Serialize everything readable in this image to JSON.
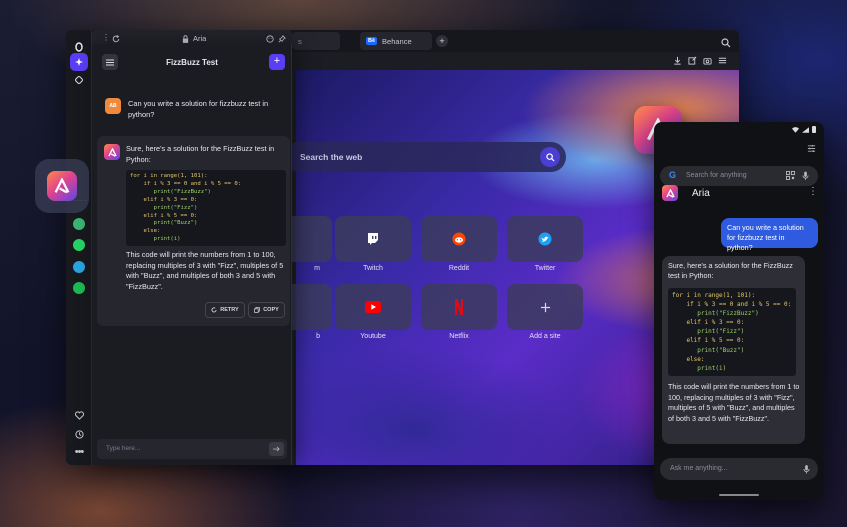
{
  "browser": {
    "tabs": [
      {
        "label": "s"
      },
      {
        "label": "Behance",
        "badge": "Bē"
      }
    ],
    "search_placeholder": "Search the web"
  },
  "speed_dial": {
    "tiles": [
      {
        "label": "m"
      },
      {
        "label": "Twitch",
        "icon": "twitch-icon"
      },
      {
        "label": "Reddit",
        "icon": "reddit-icon"
      },
      {
        "label": "Twitter",
        "icon": "twitter-icon"
      },
      {
        "label": "b"
      },
      {
        "label": "Youtube",
        "icon": "youtube-icon"
      },
      {
        "label": "Netflix",
        "icon": "netflix-icon"
      },
      {
        "label": "Add a site",
        "icon": "plus-icon"
      }
    ]
  },
  "aria": {
    "url_title": "Aria",
    "chat_title": "FizzBuzz Test",
    "user_prompt": "Can you write a solution for fizzbuzz test in python?",
    "reply_intro": "Sure, here's a solution for the FizzBuzz test in Python:",
    "reply_outro": "This code will print the numbers from 1 to 100, replacing multiples of 3 with \"Fizz\", multiples of 5 with \"Buzz\", and multiples of both 3 and 5 with \"FizzBuzz\".",
    "retry_label": "RETRY",
    "copy_label": "COPY",
    "input_placeholder": "Type here..."
  },
  "code": {
    "line1": "for i in range(1, 101):",
    "line2": "if i % 3 == 0 and i % 5 == 0:",
    "line3": "print(\"FizzBuzz\")",
    "line4": "elif i % 3 == 0:",
    "line5": "print(\"Fizz\")",
    "line6": "elif i % 5 == 0:",
    "line7": "print(\"Buzz\")",
    "line8": "else:",
    "line9": "print(i)"
  },
  "phone": {
    "search_placeholder": "Search for anything",
    "app_title": "Aria",
    "user_prompt": "Can you write a solution for fizzbuzz test in python?",
    "reply_intro": "Sure, here's a solution for the FizzBuzz test in Python:",
    "reply_outro": "This code will print the numbers from 1 to 100, replacing multiples of 3 with \"Fizz\", multiples of 5 with \"Buzz\", and multiples of both 3 and 5 with \"FizzBuzz\".",
    "input_placeholder": "Ask me anything..."
  },
  "colors": {
    "accent": "#5b3df5",
    "user_bubble": "#2f5be0",
    "aria_gradient_start": "#ff8a45",
    "aria_gradient_end": "#5a46e6"
  }
}
